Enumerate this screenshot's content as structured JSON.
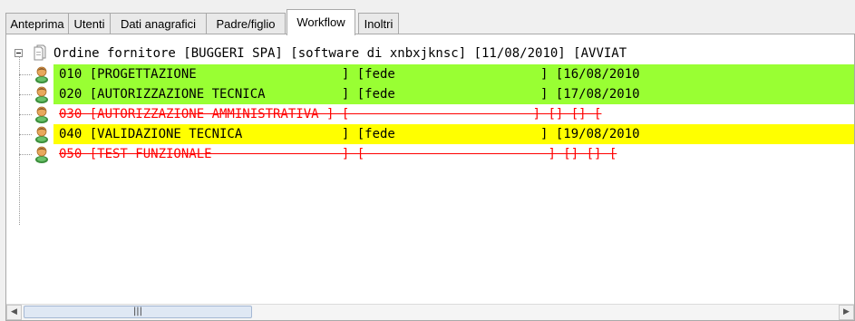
{
  "tabs": [
    {
      "label": "Anteprima",
      "active": false
    },
    {
      "label": "Utenti",
      "active": false
    },
    {
      "label": "Dati anagrafici",
      "active": false
    },
    {
      "label": "Padre/figlio",
      "active": false
    },
    {
      "label": "Workflow",
      "active": true
    },
    {
      "label": "Inoltri",
      "active": false
    }
  ],
  "tree": {
    "root": {
      "label": "Ordine fornitore [BUGGERI SPA] [software di xnbxjknsc] [11/08/2010] [AVVIAT",
      "icon": "document-icon",
      "expanded": true
    },
    "children": [
      {
        "text": "010 [PROGETTAZIONE                   ] [fede                   ] [16/08/2010",
        "style": "green",
        "icon": "user-icon"
      },
      {
        "text": "020 [AUTORIZZAZIONE TECNICA          ] [fede                   ] [17/08/2010",
        "style": "green",
        "icon": "user-icon"
      },
      {
        "text": "030 [AUTORIZZAZIONE AMMINISTRATIVA ] [                        ] [] [] [",
        "style": "struck",
        "icon": "user-icon"
      },
      {
        "text": "040 [VALIDAZIONE TECNICA             ] [fede                   ] [19/08/2010",
        "style": "yellow",
        "icon": "user-icon"
      },
      {
        "text": "050 [TEST FUNZIONALE                 ] [                        ] [] [] [",
        "style": "struck",
        "icon": "user-icon"
      }
    ]
  },
  "scrollbar": {
    "left_arrow": "◀",
    "right_arrow": "▶",
    "grip": "|||"
  },
  "colors": {
    "green_row": "#99ff33",
    "yellow_row": "#ffff00",
    "strike": "#ff0000"
  }
}
